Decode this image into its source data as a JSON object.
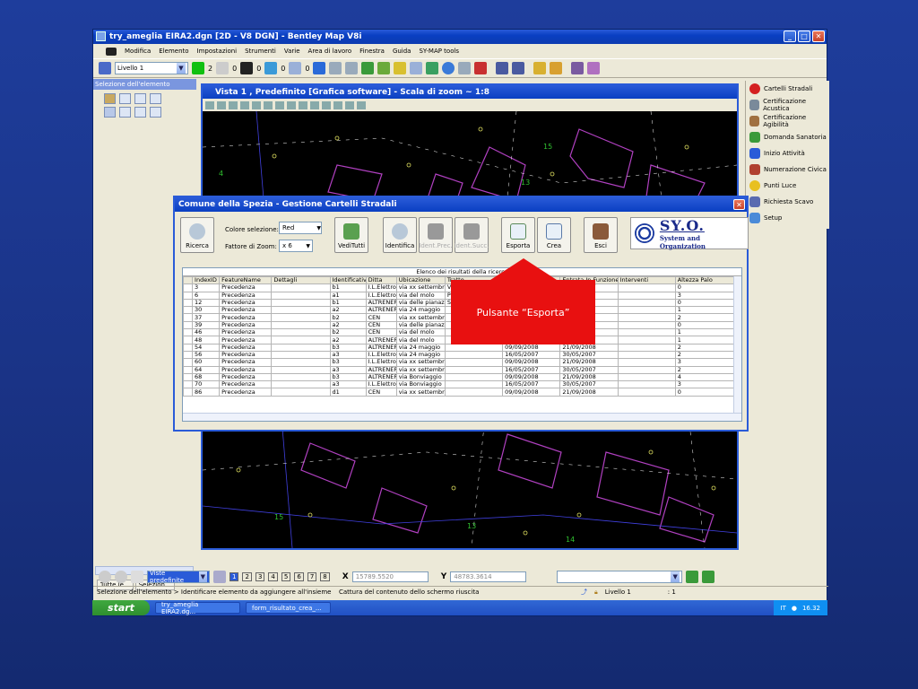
{
  "window": {
    "title": "try_ameglia EIRA2.dgn [2D - V8 DGN] - Bentley Map V8i"
  },
  "menu": [
    "Modifica",
    "Elemento",
    "Impostazioni",
    "Strumenti",
    "Varie",
    "Area di lavoro",
    "Finestra",
    "Guida",
    "SY-MAP tools"
  ],
  "toolbar": {
    "level": "Livello 1",
    "color_num": "2",
    "style_num": "0",
    "weight_num": "0",
    "transp_num": "0",
    "prio_num": "0"
  },
  "left_panel": {
    "title": "Selezione dell'elemento",
    "tabs": [
      "Tutte le...",
      "Selezion..."
    ]
  },
  "right_panel": {
    "items": [
      {
        "label": "Cartelli Stradali",
        "color": "#d42020"
      },
      {
        "label": "Certificazione Acustica",
        "color": "#7a8a9a"
      },
      {
        "label": "Certificazione Agibilità",
        "color": "#a07040"
      },
      {
        "label": "Domanda Sanatoria",
        "color": "#3a9a3a"
      },
      {
        "label": "Inizio Attività",
        "color": "#2a5bd8"
      },
      {
        "label": "Numerazione Civica",
        "color": "#b04030"
      },
      {
        "label": "Punti Luce",
        "color": "#e8c020"
      },
      {
        "label": "Richiesta Scavo",
        "color": "#5a6ab0"
      },
      {
        "label": "Setup",
        "color": "#4a8ad8"
      }
    ]
  },
  "view": {
    "title": "Vista 1 , Predefinito [Grafica software] - Scala di zoom ~ 1:8"
  },
  "dialog": {
    "title": "Comune della Spezia - Gestione Cartelli Stradali",
    "colore_label": "Colore selezione:",
    "colore_value": "Red",
    "zoom_label": "Fattore di Zoom:",
    "zoom_value": "x 6",
    "buttons": {
      "ricerca": "Ricerca",
      "veditutti": "VediTutti",
      "identifica": "Identifica",
      "identprec": "Ident.Prec.",
      "identsucc": "Ident.Succ.",
      "esporta": "Esporta",
      "crea": "Crea",
      "esci": "Esci"
    },
    "logo_big": "SY.O.",
    "logo_small": "System and Organization",
    "grid_caption": "Elenco dei risultati della ricerca",
    "columns": [
      "IndexID",
      "FeatureName",
      "Dettagli",
      "Identificativo",
      "Ditta",
      "Ubicazione",
      "Tratto",
      "Installazione",
      "Entrata In Funzione",
      "Interventi",
      "Altezza Palo"
    ],
    "rows": [
      [
        "3",
        "Precedenza",
        "",
        "b1",
        "I.L.Elettro",
        "via xx settembre",
        "VillaRosa",
        "16/05/2007",
        "30/05/2007",
        "",
        "0"
      ],
      [
        "6",
        "Precedenza",
        "",
        "a1",
        "I.L.Elettro",
        "via del molo",
        "P",
        "",
        "",
        "",
        "3"
      ],
      [
        "12",
        "Precedenza",
        "",
        "b1",
        "ALTRENER",
        "via delle pianazze",
        "S",
        "",
        "",
        "",
        "0"
      ],
      [
        "30",
        "Precedenza",
        "",
        "a2",
        "ALTRENER",
        "via 24 maggio",
        "",
        "",
        "",
        "",
        "1"
      ],
      [
        "37",
        "Precedenza",
        "",
        "b2",
        "CEN",
        "via xx settembre",
        "",
        "",
        "",
        "",
        "2"
      ],
      [
        "39",
        "Precedenza",
        "",
        "a2",
        "CEN",
        "via delle pianazze",
        "",
        "",
        "",
        "",
        "0"
      ],
      [
        "46",
        "Precedenza",
        "",
        "b2",
        "CEN",
        "via del molo",
        "",
        "",
        "",
        "",
        "1"
      ],
      [
        "48",
        "Precedenza",
        "",
        "a2",
        "ALTRENER",
        "via del molo",
        "",
        "16/05/2007",
        "30/05/2007",
        "",
        "1"
      ],
      [
        "54",
        "Precedenza",
        "",
        "b3",
        "ALTRENER",
        "via 24 maggio",
        "",
        "09/09/2008",
        "21/09/2008",
        "",
        "2"
      ],
      [
        "56",
        "Precedenza",
        "",
        "a3",
        "I.L.Elettro",
        "via 24 maggio",
        "",
        "16/05/2007",
        "30/05/2007",
        "",
        "2"
      ],
      [
        "60",
        "Precedenza",
        "",
        "b3",
        "I.L.Elettro",
        "via xx settembre",
        "",
        "09/09/2008",
        "21/09/2008",
        "",
        "3"
      ],
      [
        "64",
        "Precedenza",
        "",
        "a3",
        "ALTRENER",
        "via xx settembre",
        "",
        "16/05/2007",
        "30/05/2007",
        "",
        "2"
      ],
      [
        "68",
        "Precedenza",
        "",
        "b3",
        "ALTRENER",
        "via Bonviaggio",
        "",
        "09/09/2008",
        "21/09/2008",
        "",
        "4"
      ],
      [
        "70",
        "Precedenza",
        "",
        "a3",
        "I.L.Elettro",
        "via Bonviaggio",
        "",
        "16/05/2007",
        "30/05/2007",
        "",
        "3"
      ],
      [
        "86",
        "Precedenza",
        "",
        "d1",
        "CEN",
        "via xx settembre",
        "",
        "09/09/2008",
        "21/09/2008",
        "",
        "0"
      ]
    ]
  },
  "callout": {
    "text": "Pulsante “Esporta”"
  },
  "status": {
    "views_label": "Viste predefinite",
    "view_nums": [
      "1",
      "2",
      "3",
      "4",
      "5",
      "6",
      "7",
      "8"
    ],
    "x_label": "X",
    "x_value": "15789.5520",
    "y_label": "Y",
    "y_value": "48783.3614",
    "left_msg": "Selezione dell'elemento > Identificare elemento da aggiungere all'insieme",
    "mid_msg": "Cattura del contenuto dello schermo riuscita",
    "level": "Livello 1",
    "sel": ": 1"
  },
  "taskbar": {
    "start": "start",
    "tasks": [
      "try_ameglia EIRA2.dg...",
      "form_risultato_crea_..."
    ],
    "lang": "IT",
    "time": "16.32"
  },
  "map": {
    "labels": [
      "4",
      "15",
      "13",
      "15",
      "13",
      "14"
    ]
  },
  "colors": {
    "accent": "#2a5bd8",
    "callout": "#e81010",
    "map_lines": "#b040c0"
  }
}
